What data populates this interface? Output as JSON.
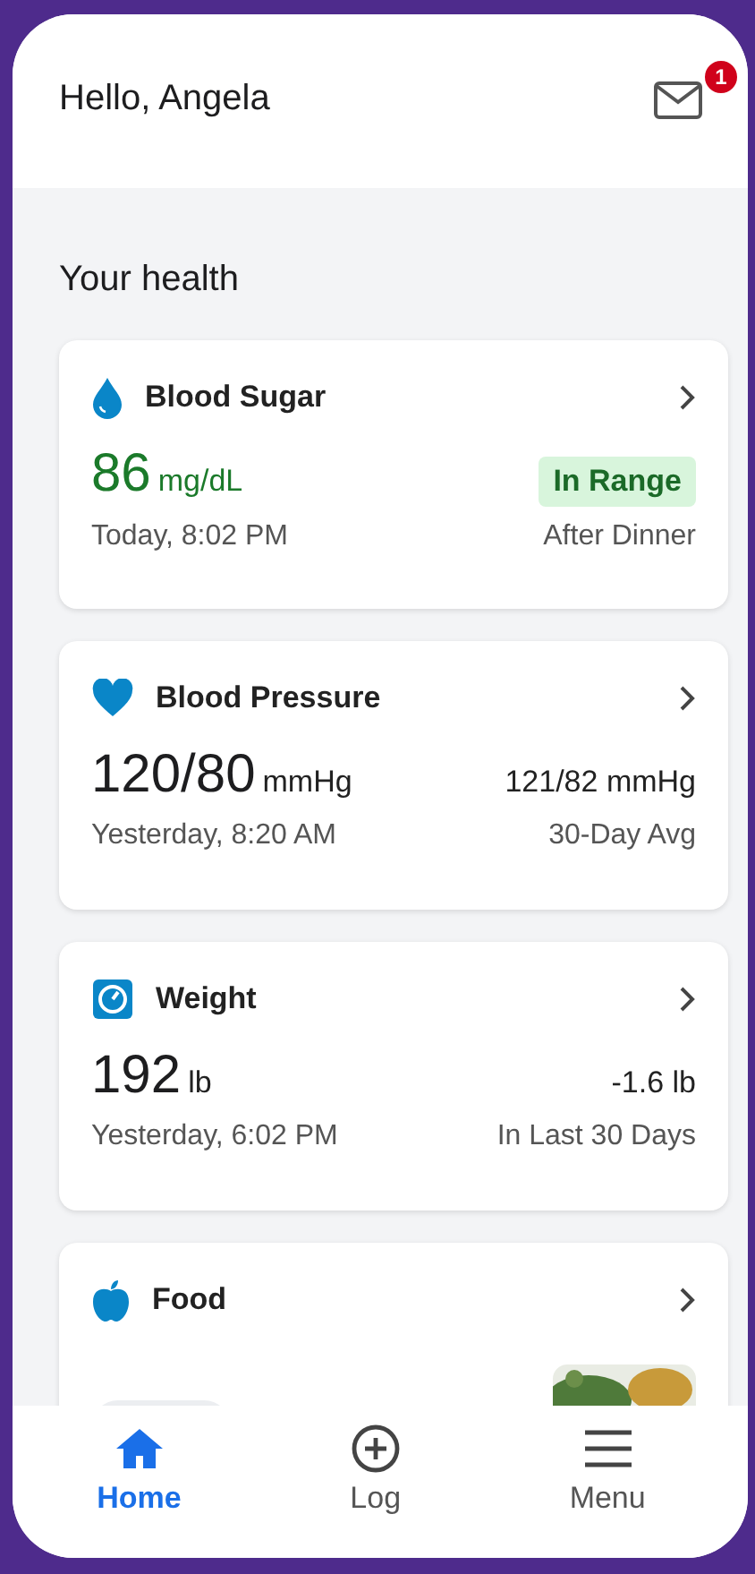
{
  "header": {
    "greeting": "Hello, Angela",
    "inbox_badge": "1"
  },
  "section_title": "Your health",
  "cards": [
    {
      "kind": "drop",
      "title": "Blood Sugar",
      "value": "86",
      "unit": "mg/dL",
      "in_range": true,
      "side": {
        "kind": "badge",
        "text": "In Range"
      },
      "time": "Today, 8:02 PM",
      "note": "After Dinner"
    },
    {
      "kind": "heart",
      "title": "Blood Pressure",
      "value": "120/80",
      "unit": "mmHg",
      "in_range": false,
      "side": {
        "kind": "text",
        "text": "121/82 mmHg"
      },
      "time": "Yesterday, 8:20 AM",
      "note": "30-Day Avg"
    },
    {
      "kind": "scale",
      "title": "Weight",
      "value": "192",
      "unit": "lb",
      "in_range": false,
      "side": {
        "kind": "text",
        "text": "-1.6 lb"
      },
      "time": "Yesterday, 6:02 PM",
      "note": "In Last 30 Days"
    },
    {
      "kind": "apple",
      "title": "Food"
    }
  ],
  "nav": [
    {
      "kind": "home",
      "label": "Home",
      "selected": true
    },
    {
      "kind": "plus",
      "label": "Log",
      "selected": false
    },
    {
      "kind": "menu",
      "label": "Menu",
      "selected": false
    }
  ]
}
